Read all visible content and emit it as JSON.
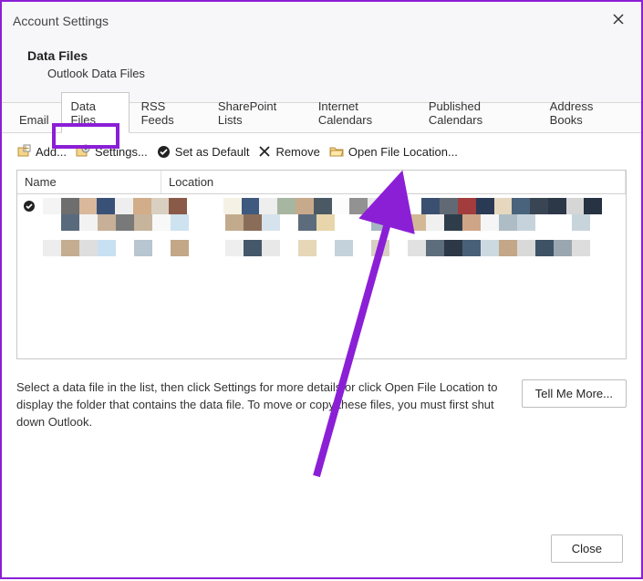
{
  "window": {
    "title": "Account Settings",
    "close_icon": "✕"
  },
  "header": {
    "heading": "Data Files",
    "subheading": "Outlook Data Files"
  },
  "tabs": [
    {
      "label": "Email",
      "active": false
    },
    {
      "label": "Data Files",
      "active": true
    },
    {
      "label": "RSS Feeds",
      "active": false
    },
    {
      "label": "SharePoint Lists",
      "active": false
    },
    {
      "label": "Internet Calendars",
      "active": false
    },
    {
      "label": "Published Calendars",
      "active": false
    },
    {
      "label": "Address Books",
      "active": false
    }
  ],
  "toolbar": {
    "add": "Add...",
    "settings": "Settings...",
    "set_default": "Set as Default",
    "remove": "Remove",
    "open_location": "Open File Location..."
  },
  "table": {
    "columns": {
      "name": "Name",
      "location": "Location"
    }
  },
  "description": {
    "text": "Select a data file in the list, then click Settings for more details or click Open File Location to display the folder that contains the data file. To move or copy these files, you must first shut down Outlook.",
    "tell_me_more": "Tell Me More..."
  },
  "footer": {
    "close": "Close"
  },
  "colors": {
    "accent": "#8b1fd6"
  }
}
